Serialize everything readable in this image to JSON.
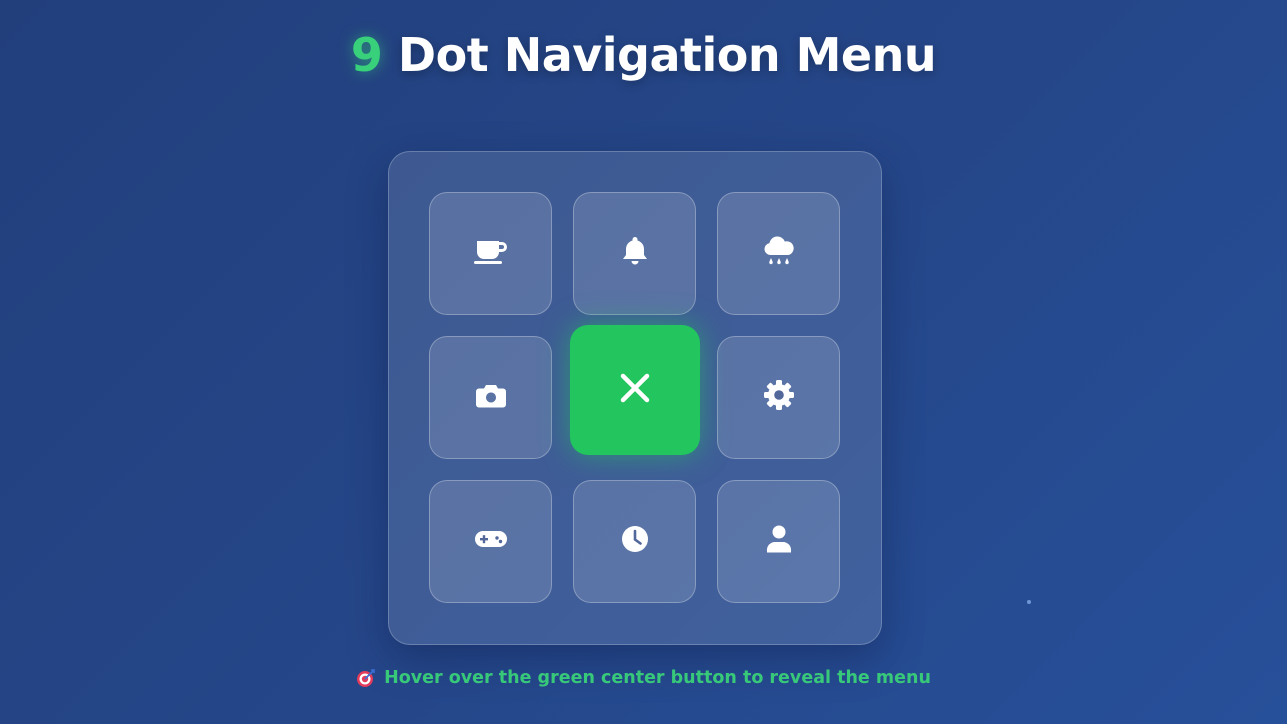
{
  "header": {
    "title_accent": "9",
    "title_text": " Dot Navigation Menu"
  },
  "menu": {
    "items": [
      {
        "icon": "coffee-icon"
      },
      {
        "icon": "bell-icon"
      },
      {
        "icon": "cloud-rain-icon"
      },
      {
        "icon": "camera-icon"
      },
      {
        "icon": "gear-icon"
      },
      {
        "icon": "gamepad-icon"
      },
      {
        "icon": "clock-icon"
      },
      {
        "icon": "user-icon"
      }
    ],
    "center": {
      "icon": "close-icon"
    }
  },
  "hint": {
    "icon": "target-icon",
    "text": "Hover over the green center button to reveal the menu"
  },
  "colors": {
    "accent": "#22c55e",
    "hint_text": "#38c879",
    "background": "#25478a"
  }
}
